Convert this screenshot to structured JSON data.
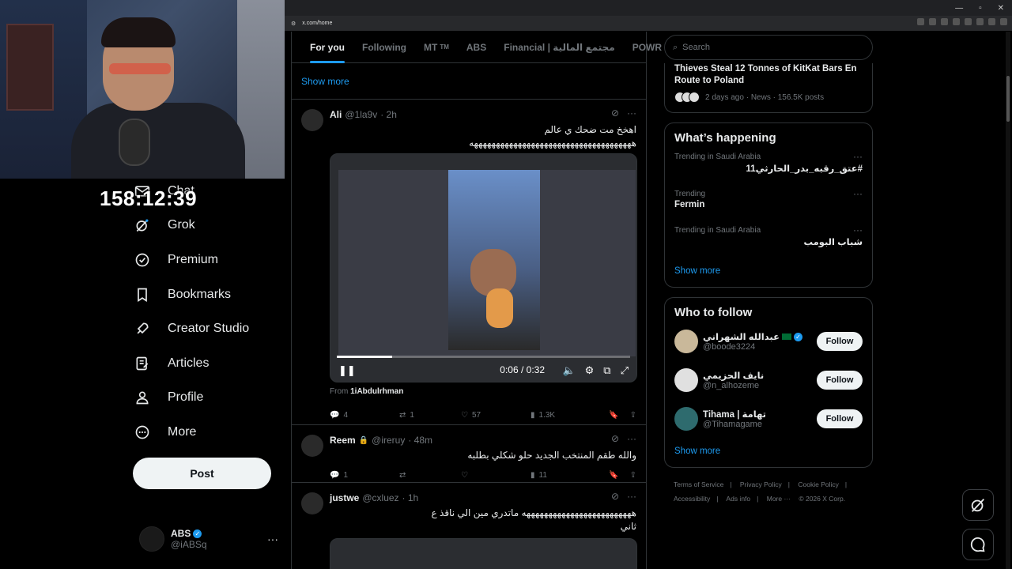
{
  "stream": {
    "timer": "158:12:39"
  },
  "sidebar": {
    "items": [
      {
        "label": "Chat",
        "icon": "mail-icon"
      },
      {
        "label": "Grok",
        "icon": "grok-icon"
      },
      {
        "label": "Premium",
        "icon": "verified-icon"
      },
      {
        "label": "Bookmarks",
        "icon": "bookmark-icon"
      },
      {
        "label": "Creator Studio",
        "icon": "rocket-icon"
      },
      {
        "label": "Articles",
        "icon": "article-icon"
      },
      {
        "label": "Profile",
        "icon": "person-icon"
      },
      {
        "label": "More",
        "icon": "more-circle-icon"
      }
    ],
    "post_label": "Post",
    "account": {
      "name": "ABS",
      "handle": "@iABSq",
      "more": "···"
    }
  },
  "browser": {
    "url": "x.com/home"
  },
  "timeline": {
    "tabs": [
      {
        "label": "For you",
        "active": true
      },
      {
        "label": "Following"
      },
      {
        "label": "MT",
        "suffix": "TM"
      },
      {
        "label": "ABS"
      },
      {
        "label": "Financial | مجتمع المالية"
      },
      {
        "label": "POWR | ور"
      }
    ],
    "show_more": "Show more",
    "tweets": [
      {
        "name": "Ali",
        "handle": "@1la9v",
        "time": "· 2h",
        "text_line1": "اهخخ مت ضحك ي عالم",
        "text_line2": "هههههههههههههههههههههههههههههههههههههه",
        "video_time": "0:06 / 0:32",
        "video_progress": 0.19,
        "from_label": "From",
        "from_user": "1iAbdulrhman",
        "replies": "4",
        "reposts": "1",
        "likes": "57",
        "views": "1.3K"
      },
      {
        "name": "Reem",
        "handle": "@ireruy",
        "time": "· 48m",
        "text": "والله طقم المنتخب الجديد حلو شكلي بطلبه",
        "replies": "1",
        "reposts": "",
        "likes": "",
        "views": "11"
      },
      {
        "name": "justwe",
        "handle": "@cxluez",
        "time": "· 1h",
        "text_line1": "هههههههههههههههههههههههههه ماتدري مين الي ناقذ ع",
        "text_line2": "ثاني"
      }
    ]
  },
  "right": {
    "search_placeholder": "Search",
    "news": {
      "title": "Thieves Steal 12 Tonnes of KitKat Bars En Route to Poland",
      "meta": "2 days ago · News · 156.5K posts"
    },
    "happening": {
      "heading": "What’s happening",
      "trends": [
        {
          "context": "Trending in Saudi Arabia",
          "title": "#عتق_رقبه_بدر_الحارثي11",
          "rtl": true
        },
        {
          "context": "Trending",
          "title": "Fermin",
          "rtl": false
        },
        {
          "context": "Trending in Saudi Arabia",
          "title": "شباب البومب",
          "rtl": true
        }
      ],
      "show_more": "Show more"
    },
    "who_to_follow": {
      "heading": "Who to follow",
      "users": [
        {
          "name": "عبدالله الشهراني",
          "handle": "@boode3224",
          "button": "Follow",
          "flag": true,
          "verified": true
        },
        {
          "name": "نايف الحزيمي",
          "handle": "@n_alhozeme",
          "button": "Follow"
        },
        {
          "name": "Tihama | تهامة",
          "handle": "@Tihamagame",
          "button": "Follow"
        }
      ],
      "show_more": "Show more"
    },
    "footer": {
      "links": [
        "Terms of Service",
        "|",
        "Privacy Policy",
        "|",
        "Cookie Policy",
        "|"
      ],
      "links2": [
        "Accessibility",
        "|",
        "Ads info",
        "|",
        "More ···",
        "© 2026 X Corp."
      ]
    }
  },
  "colors": {
    "accent": "#1d9bf0",
    "background": "#000000",
    "border": "#2f3336",
    "muted": "#71767b"
  }
}
